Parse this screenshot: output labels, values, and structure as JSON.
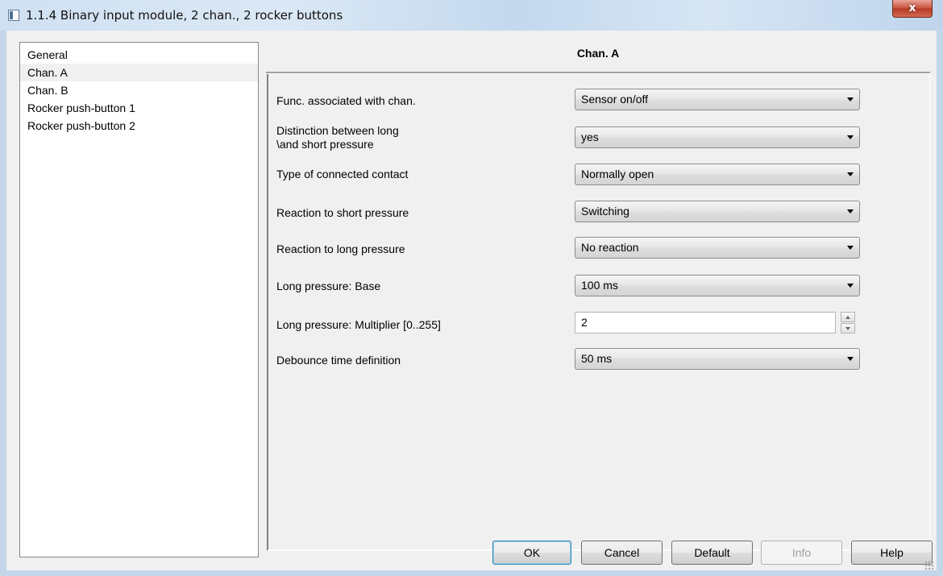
{
  "window": {
    "title": "1.1.4 Binary input module, 2 chan., 2 rocker buttons",
    "close_label": "x"
  },
  "tree": {
    "items": [
      {
        "label": "General",
        "selected": false
      },
      {
        "label": "Chan. A",
        "selected": true
      },
      {
        "label": "Chan. B",
        "selected": false
      },
      {
        "label": "Rocker push-button 1",
        "selected": false
      },
      {
        "label": "Rocker push-button 2",
        "selected": false
      }
    ]
  },
  "panel": {
    "title": "Chan. A",
    "params": [
      {
        "label": "Func. associated with chan.",
        "value": "Sensor on/off"
      },
      {
        "label_line1": "Distinction between long",
        "label_line2": "\\and short pressure",
        "value": "yes"
      },
      {
        "label": "Type of connected contact",
        "value": "Normally open"
      },
      {
        "label": "Reaction to short pressure",
        "value": "Switching"
      },
      {
        "label": "Reaction to long pressure",
        "value": "No reaction"
      },
      {
        "label": "Long pressure: Base",
        "value": "100 ms"
      },
      {
        "label": "Long pressure: Multiplier [0..255]",
        "value": "2"
      },
      {
        "label": "Debounce time definition",
        "value": "50 ms"
      }
    ]
  },
  "buttons": {
    "ok": "OK",
    "cancel": "Cancel",
    "default": "Default",
    "info": "Info",
    "help": "Help"
  }
}
